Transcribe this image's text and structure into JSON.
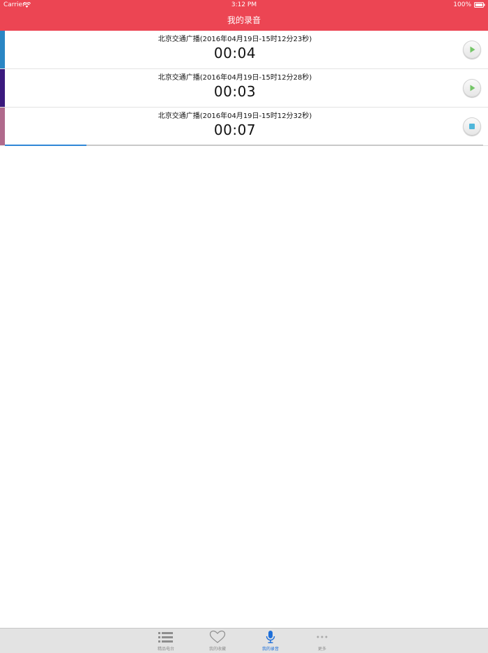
{
  "status_bar": {
    "carrier": "Carrier",
    "time": "3:12 PM",
    "battery": "100%"
  },
  "nav": {
    "title": "我的录音"
  },
  "recordings": [
    {
      "title": "北京交通广播(2016年04月19日-15时12分23秒)",
      "duration": "00:04",
      "accent_color": "#2a86c4",
      "control": "play-icon",
      "state": "idle"
    },
    {
      "title": "北京交通广播(2016年04月19日-15时12分28秒)",
      "duration": "00:03",
      "accent_color": "#3b1a7e",
      "control": "play-icon",
      "state": "idle"
    },
    {
      "title": "北京交通广播(2016年04月19日-15时12分32秒)",
      "duration": "00:07",
      "accent_color": "#b06a8c",
      "control": "stop-icon",
      "state": "playing",
      "progress": 0.17
    }
  ],
  "tabs": [
    {
      "label": "精品电台",
      "icon": "list-icon",
      "active": false
    },
    {
      "label": "我的收藏",
      "icon": "heart-icon",
      "active": false
    },
    {
      "label": "我的录音",
      "icon": "microphone-icon",
      "active": true
    },
    {
      "label": "更多",
      "icon": "more-icon",
      "active": false
    }
  ],
  "colors": {
    "brand_red": "#ec4553",
    "tab_active": "#1e6fd9",
    "progress": "#2f86d6"
  }
}
